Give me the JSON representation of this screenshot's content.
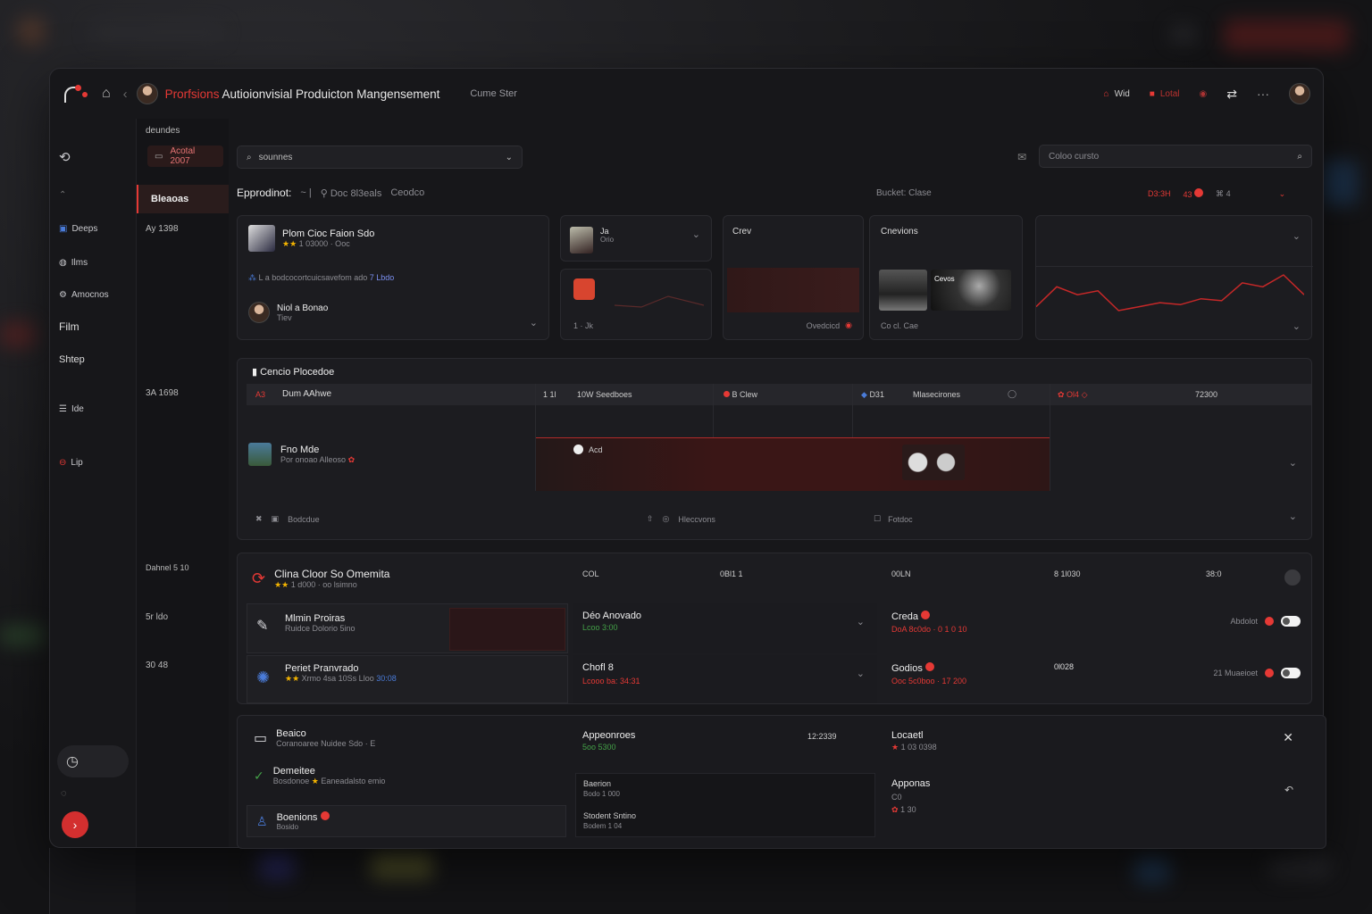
{
  "app": {
    "title_accent": "Prorfsions",
    "title": "Autioionvisial Produicton Mangensement",
    "subtitle": "Cume Ster"
  },
  "topbar": {
    "item1": "Wid",
    "item2": "Lotal"
  },
  "sidebar": {
    "label_top": "deundes",
    "items": [
      {
        "label": "Deeps"
      },
      {
        "label": "Ilms"
      },
      {
        "label": "Amocnos"
      },
      {
        "label": "Film"
      },
      {
        "label": "Shtep"
      },
      {
        "label": "Ide"
      },
      {
        "label": "Lip"
      }
    ]
  },
  "sub_sidebar": {
    "active": "Bleaoas",
    "labels": [
      "Ay 1398",
      "3A 1698",
      "Dahnel 5 10",
      "5r ldo",
      "30 48"
    ]
  },
  "filters": {
    "dropdown": "Acotal 2007",
    "search_value": "sounnes",
    "right_search_placeholder": "Coloo cursto"
  },
  "overview": {
    "heading": "Epprodinot:",
    "tab1": "Doc 8l3eals",
    "tab2": "Ceodco",
    "budget_label": "Bucket: Clase",
    "budget_val1": "D3:3H",
    "budget_val2": "43",
    "budget_val3": "4"
  },
  "card_profile": {
    "name": "Plom Cioc Faion Sdo",
    "rating": "1 03000 · Ooc",
    "desc": "L a bodcocortcuicsavefom ado",
    "desc_link": "7 Lbdo",
    "user_name": "Niol a Bonao",
    "user_sub": "Tiev"
  },
  "card_mini": {
    "title": "Ja",
    "sub": "Orio",
    "footer": "1 · Jk"
  },
  "card_crew": {
    "title": "Crev",
    "footer": "Ovedcicd"
  },
  "card_creations": {
    "title": "Cnevions",
    "thumb_label": "Cevos",
    "footer": "Co cl. Cae"
  },
  "chart_data": {
    "type": "line",
    "values": [
      12,
      22,
      18,
      20,
      10,
      12,
      14,
      13,
      16,
      15,
      24,
      22,
      28,
      18
    ],
    "color": "#c62828"
  },
  "schedule": {
    "title": "Cencio Plocedoe",
    "header": {
      "c0_badge": "A3",
      "c0": "Dum AAhwe",
      "c1": "1 1l",
      "c1b": "10W Seedboes",
      "c2": "B Clew",
      "c3a": "D31",
      "c3": "Mlasecirones",
      "c4a": "Ol4",
      "c4": "72300"
    },
    "row": {
      "name": "Fno Mde",
      "sub": "Por onoao Alleoso",
      "tag": "Acd"
    },
    "footer": {
      "f1": "Bodcdue",
      "f2": "Hleccvons",
      "f3": "Fotdoc"
    }
  },
  "projects": {
    "head": {
      "name": "Clina Cloor So Omemita",
      "sub": "1 d000 · oo lsimno",
      "c1": "COL",
      "c2": "0Bl1 1",
      "c3": "00LN",
      "c4": "8 1l030",
      "c5": "38:0"
    },
    "rows": [
      {
        "name": "Mlmin Proiras",
        "sub": "Ruidce Dolorio 5ino",
        "mid": "Déo Anovado",
        "mid_sub": "Lcoo 3:00",
        "right": "Creda",
        "right_sub": "DoA 8c0do · 0 1 0 10",
        "status": "Abdolot"
      },
      {
        "name": "Periet Pranvrado",
        "sub": "Xrmo 4sa 10Ss Lloo",
        "sub_accent": "30:08",
        "mid": "Chofl 8",
        "mid_sub": "Lcooo ba: 34:31",
        "extra": "0l028",
        "right": "Godios",
        "right_sub": "Ooc 5c0boo · 17 200",
        "status": "21 Muaeioet"
      }
    ]
  },
  "bottom": {
    "items": [
      {
        "name": "Beaico",
        "sub": "Coranoaree Nuidee Sdo · E"
      },
      {
        "name": "Demeitee",
        "sub": "Bosdonoe",
        "sub2": "Eaneadalsto emio"
      },
      {
        "name": "Boenions",
        "sub": "Bosido"
      }
    ],
    "mid_title": "Appeonroes",
    "mid_sub": "5oo 5300",
    "mid_time": "12:2339",
    "mid_box1_a": "Baerion",
    "mid_box1_b": "Bodo 1 000",
    "mid_box2_a": "Stodent Sntino",
    "mid_box2_b": "Bodem 1 04",
    "right_title": "Locaetl",
    "right_sub": "1 03 0398",
    "right2_title": "Apponas",
    "right2_sub": "C0",
    "right2_sub2": "1 30"
  }
}
